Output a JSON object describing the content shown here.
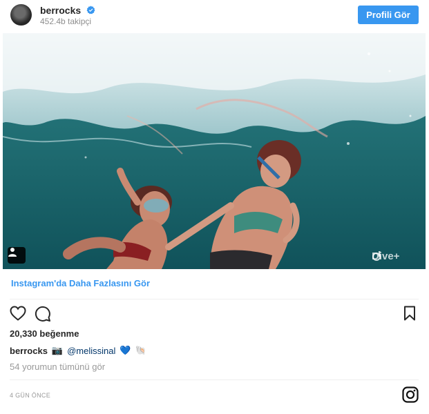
{
  "header": {
    "username": "berrocks",
    "followers": "452.4b takipçi",
    "profile_button": "Profili Gör"
  },
  "photo": {
    "watermark": "Dive+",
    "user_tag_icon": "person-icon"
  },
  "more_link": "Instagram'da Daha Fazlasını Gör",
  "actions": {
    "like_icon": "heart-icon",
    "comment_icon": "comment-icon",
    "save_icon": "bookmark-icon"
  },
  "likes": "20,330 beğenme",
  "caption": {
    "author": "berrocks",
    "camera_emoji": "📷",
    "mention": "@melissinal",
    "heart_emoji": "💙",
    "shell_emoji": "🐚"
  },
  "comments_link": "54 yorumun tümünü gör",
  "timestamp": "4 GÜN ÖNCE",
  "colors": {
    "accent": "#3897f0",
    "text": "#262626",
    "muted": "#999999"
  }
}
